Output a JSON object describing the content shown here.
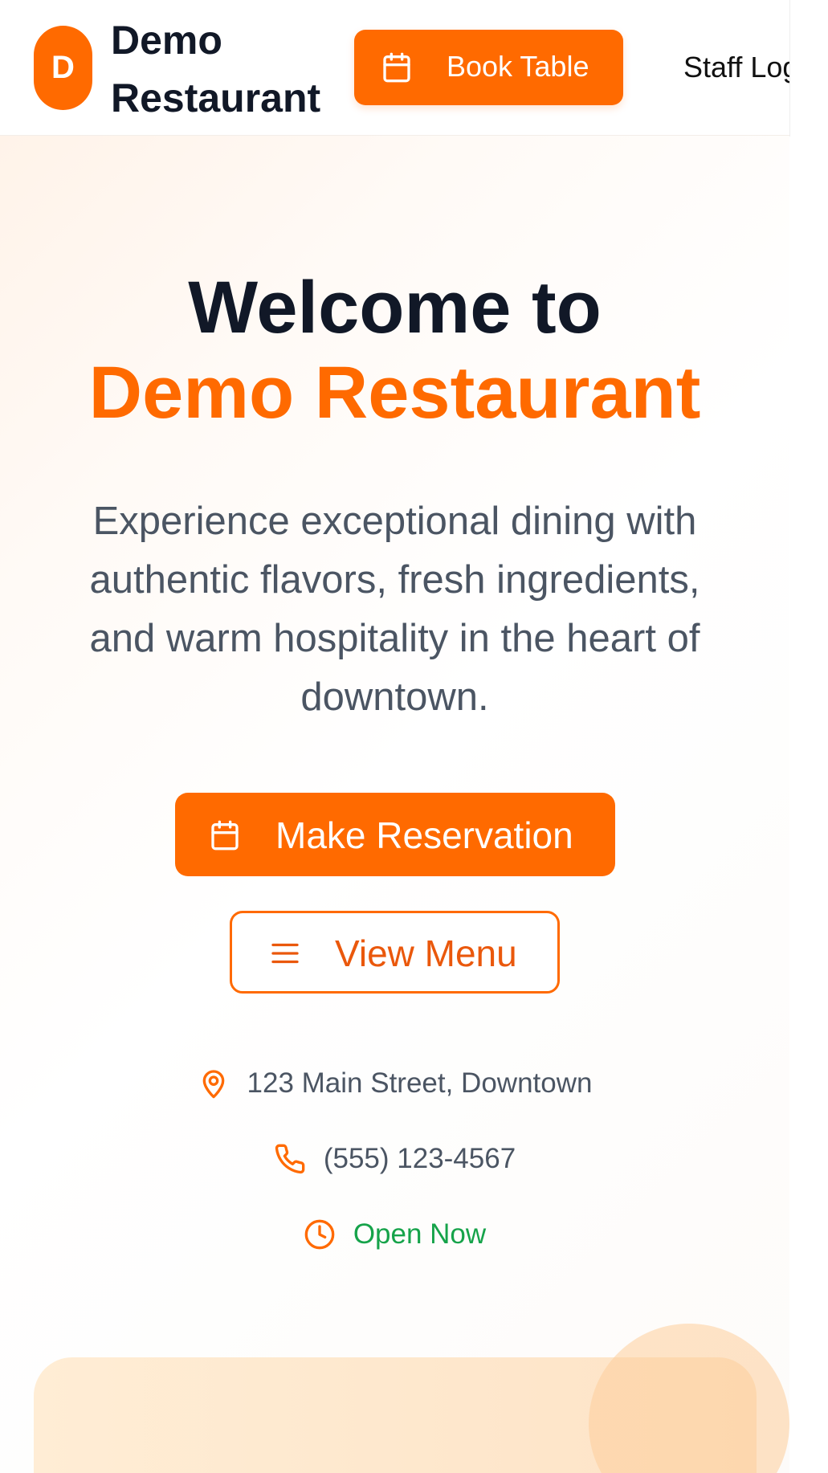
{
  "header": {
    "logo_letter": "D",
    "brand_name": "Demo Restaurant",
    "book_button_label": "Book Table",
    "staff_login_label": "Staff Login"
  },
  "hero": {
    "title_line1": "Welcome to",
    "title_line2": "Demo Restaurant",
    "description": "Experience exceptional dining with authentic flavors, fresh ingredients, and warm hospitality in the heart of downtown.",
    "reserve_button_label": "Make Reservation",
    "menu_button_label": "View Menu",
    "address": "123 Main Street, Downtown",
    "phone": "(555) 123-4567",
    "status": "Open Now"
  },
  "colors": {
    "accent": "#ff6a00",
    "heading": "#111827",
    "body_text": "#4b5563",
    "status_open": "#16a34a"
  },
  "icons": {
    "book_button": "calendar-icon",
    "reserve_button": "calendar-icon",
    "menu_button": "menu-lines-icon",
    "address": "map-pin-icon",
    "phone": "phone-icon",
    "status": "clock-icon"
  }
}
